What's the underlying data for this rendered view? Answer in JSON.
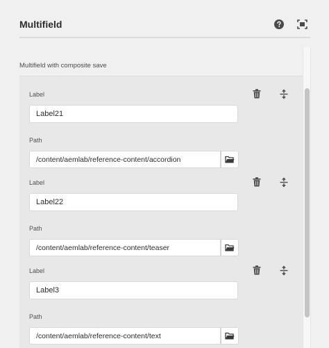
{
  "dialog": {
    "title": "Multifield",
    "help_icon": "help-circle-icon",
    "fullscreen_icon": "fullscreen-icon"
  },
  "multifield": {
    "label": "Multifield with composite save",
    "items": [
      {
        "label_field_label": "Label",
        "label_value": "Label21",
        "path_field_label": "Path",
        "path_value": "/content/aemlab/reference-content/accordion"
      },
      {
        "label_field_label": "Label",
        "label_value": "Label22",
        "path_field_label": "Path",
        "path_value": "/content/aemlab/reference-content/teaser"
      },
      {
        "label_field_label": "Label",
        "label_value": "Label3",
        "path_field_label": "Path",
        "path_value": "/content/aemlab/reference-content/text"
      }
    ],
    "item_icons": {
      "delete": "trash-icon",
      "move": "reorder-icon",
      "browse": "folder-icon"
    }
  }
}
